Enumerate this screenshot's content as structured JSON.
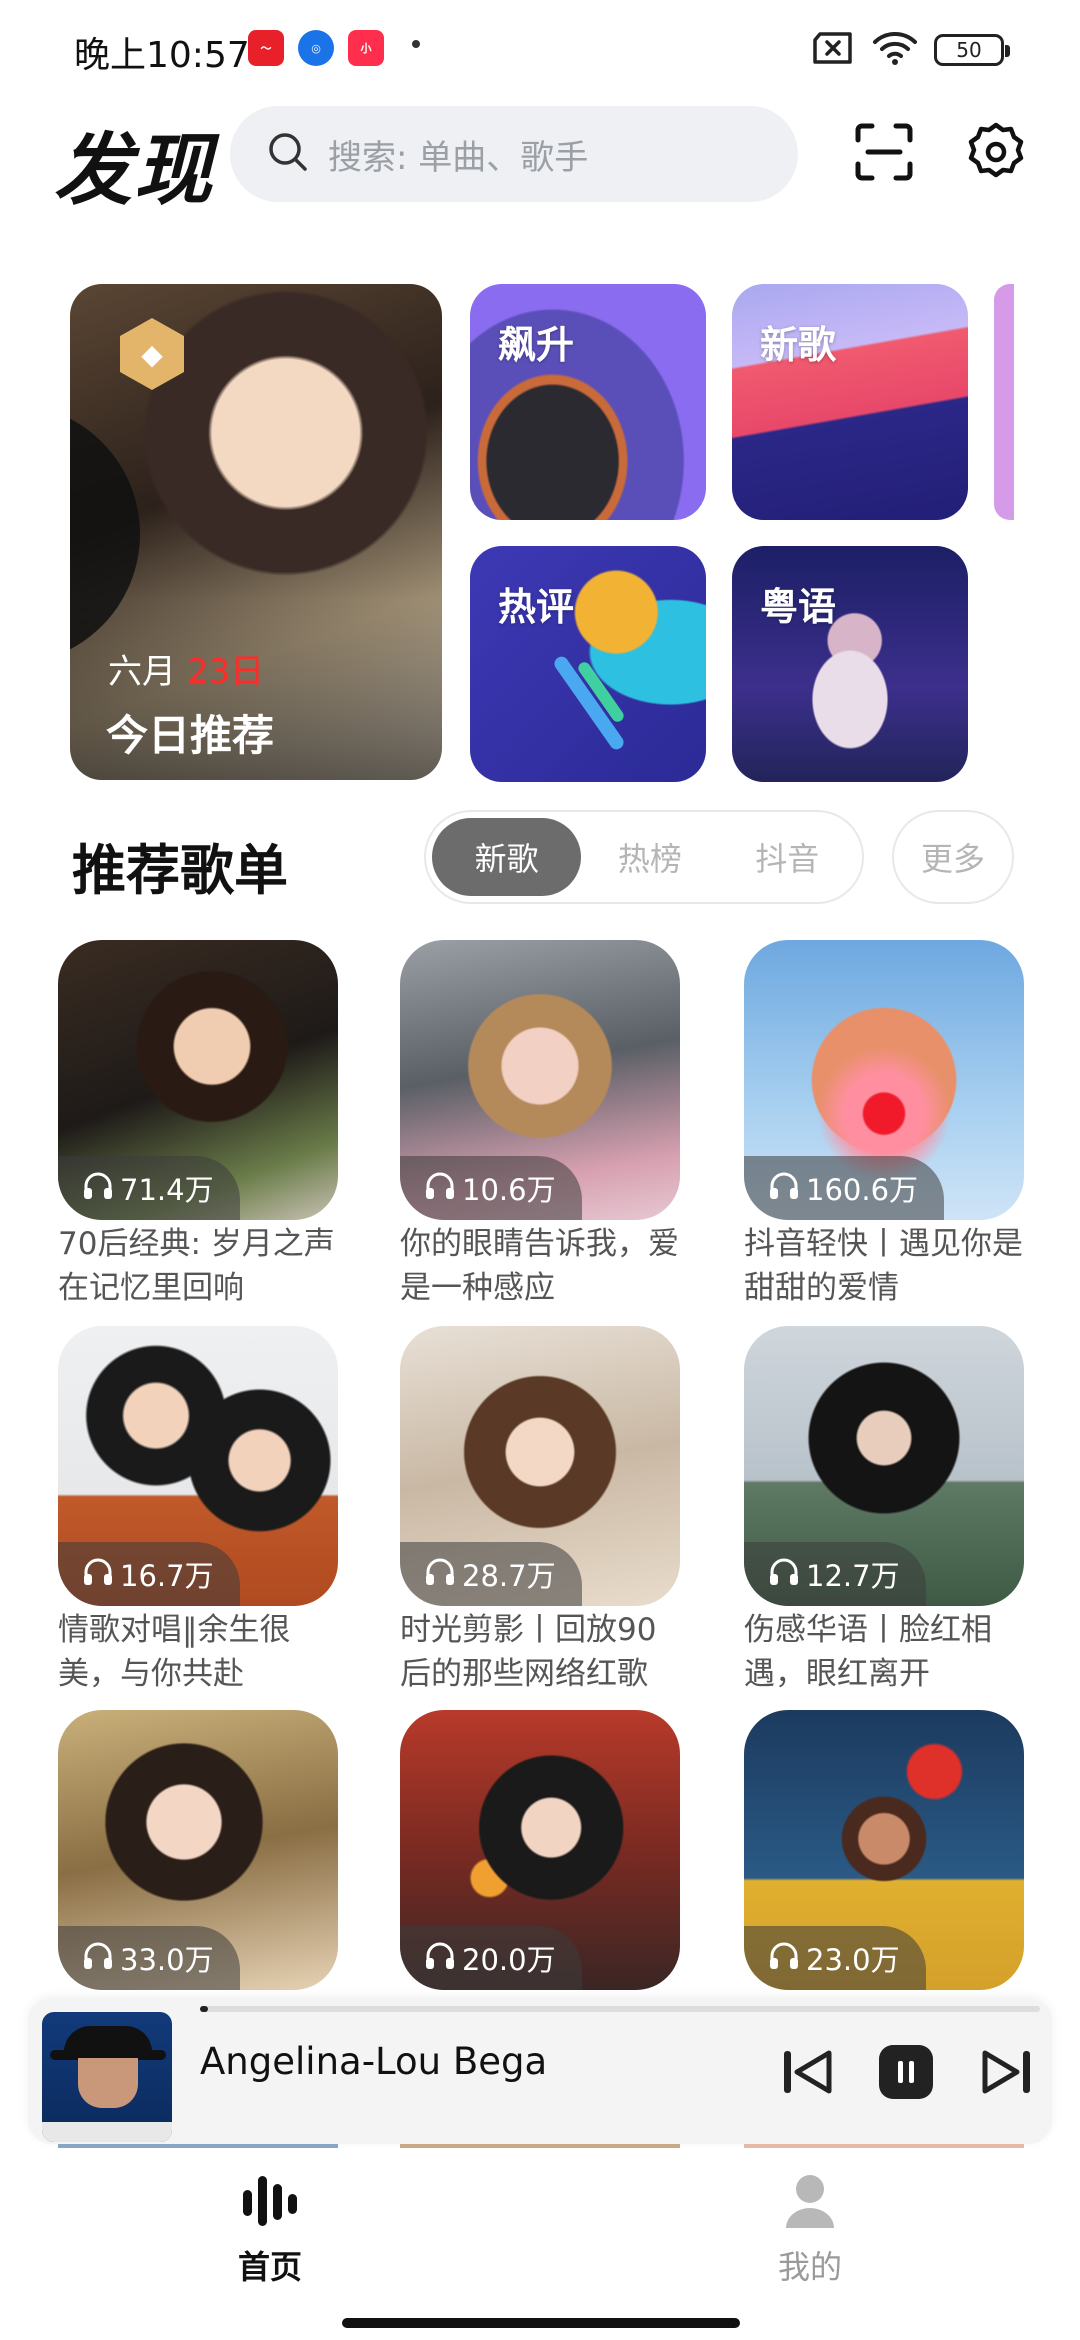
{
  "status_bar": {
    "time": "晚上10:57",
    "battery": "50"
  },
  "header": {
    "title": "发现",
    "search_placeholder": "搜索: 单曲、歌手"
  },
  "tiles": {
    "daily": {
      "month_label": "六月",
      "day_label": "23日",
      "label": "今日推荐"
    },
    "rising": "飙升",
    "new_songs": "新歌",
    "hot_comments": "热评",
    "cantonese": "粤语"
  },
  "playlists_section": {
    "title": "推荐歌单",
    "tabs": [
      "新歌",
      "热榜",
      "抖音"
    ],
    "more": "更多",
    "items": [
      {
        "plays": "71.4万",
        "title": "70后经典: 岁月之声在记忆里回响"
      },
      {
        "plays": "10.6万",
        "title": "你的眼睛告诉我，爱是一种感应"
      },
      {
        "plays": "160.6万",
        "title": "抖音轻快丨遇见你是甜甜的爱情"
      },
      {
        "plays": "16.7万",
        "title": "情歌对唱‖余生很美，与你共赴"
      },
      {
        "plays": "28.7万",
        "title": "时光剪影丨回放90后的那些网络红歌"
      },
      {
        "plays": "12.7万",
        "title": "伤感华语丨脸红相遇，眼红离开"
      },
      {
        "plays": "33.0万",
        "title": ""
      },
      {
        "plays": "20.0万",
        "title": ""
      },
      {
        "plays": "23.0万",
        "title": ""
      }
    ]
  },
  "player": {
    "song": "Angelina-Lou Bega",
    "progress": 0.01
  },
  "bottom_nav": {
    "home": "首页",
    "mine": "我的"
  }
}
